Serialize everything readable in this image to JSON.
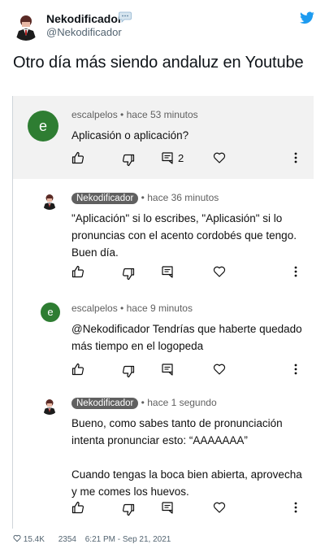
{
  "tweet": {
    "author_name": "Nekodificador",
    "author_handle": "@Nekodificador",
    "text": "Otro día más siendo andaluz en Youtube",
    "likes": "15.4K",
    "retweets": "2354",
    "timestamp": "6:21 PM - Sep 21, 2021"
  },
  "comments": [
    {
      "author": "escalpelos",
      "avatar_letter": "e",
      "time": "hace 53 minutos",
      "text": "Aplicasión o aplicación?",
      "reply_count": "2"
    },
    {
      "author": "Nekodificador",
      "time": "hace 36 minutos",
      "text": "\"Aplicación\" si lo escribes, \"Aplicasión\" si lo pronuncias con el acento cordobés que tengo. Buen día."
    },
    {
      "author": "escalpelos",
      "avatar_letter": "e",
      "time": "hace 9 minutos",
      "text": " @Nekodificador  Tendrías que haberte quedado más tiempo en el logopeda"
    },
    {
      "author": "Nekodificador",
      "time": "hace 1 segundo",
      "text_p1": "Bueno, como sabes tanto de pronunciación intenta pronunciar esto: “AAAAAAA”",
      "text_p2": "Cuando tengas la boca bien abierta, aprovecha y me comes los huevos."
    }
  ],
  "separator": "•",
  "icons": [
    "speech-bubble-icon",
    "twitter-bird-icon",
    "thumbs-up-icon",
    "thumbs-down-icon",
    "reply-icon",
    "heart-icon",
    "more-vertical-icon"
  ],
  "colors": {
    "twitter_blue": "#1d9bf0",
    "avatar_green": "#2e7d32",
    "badge_gray": "#606060"
  }
}
